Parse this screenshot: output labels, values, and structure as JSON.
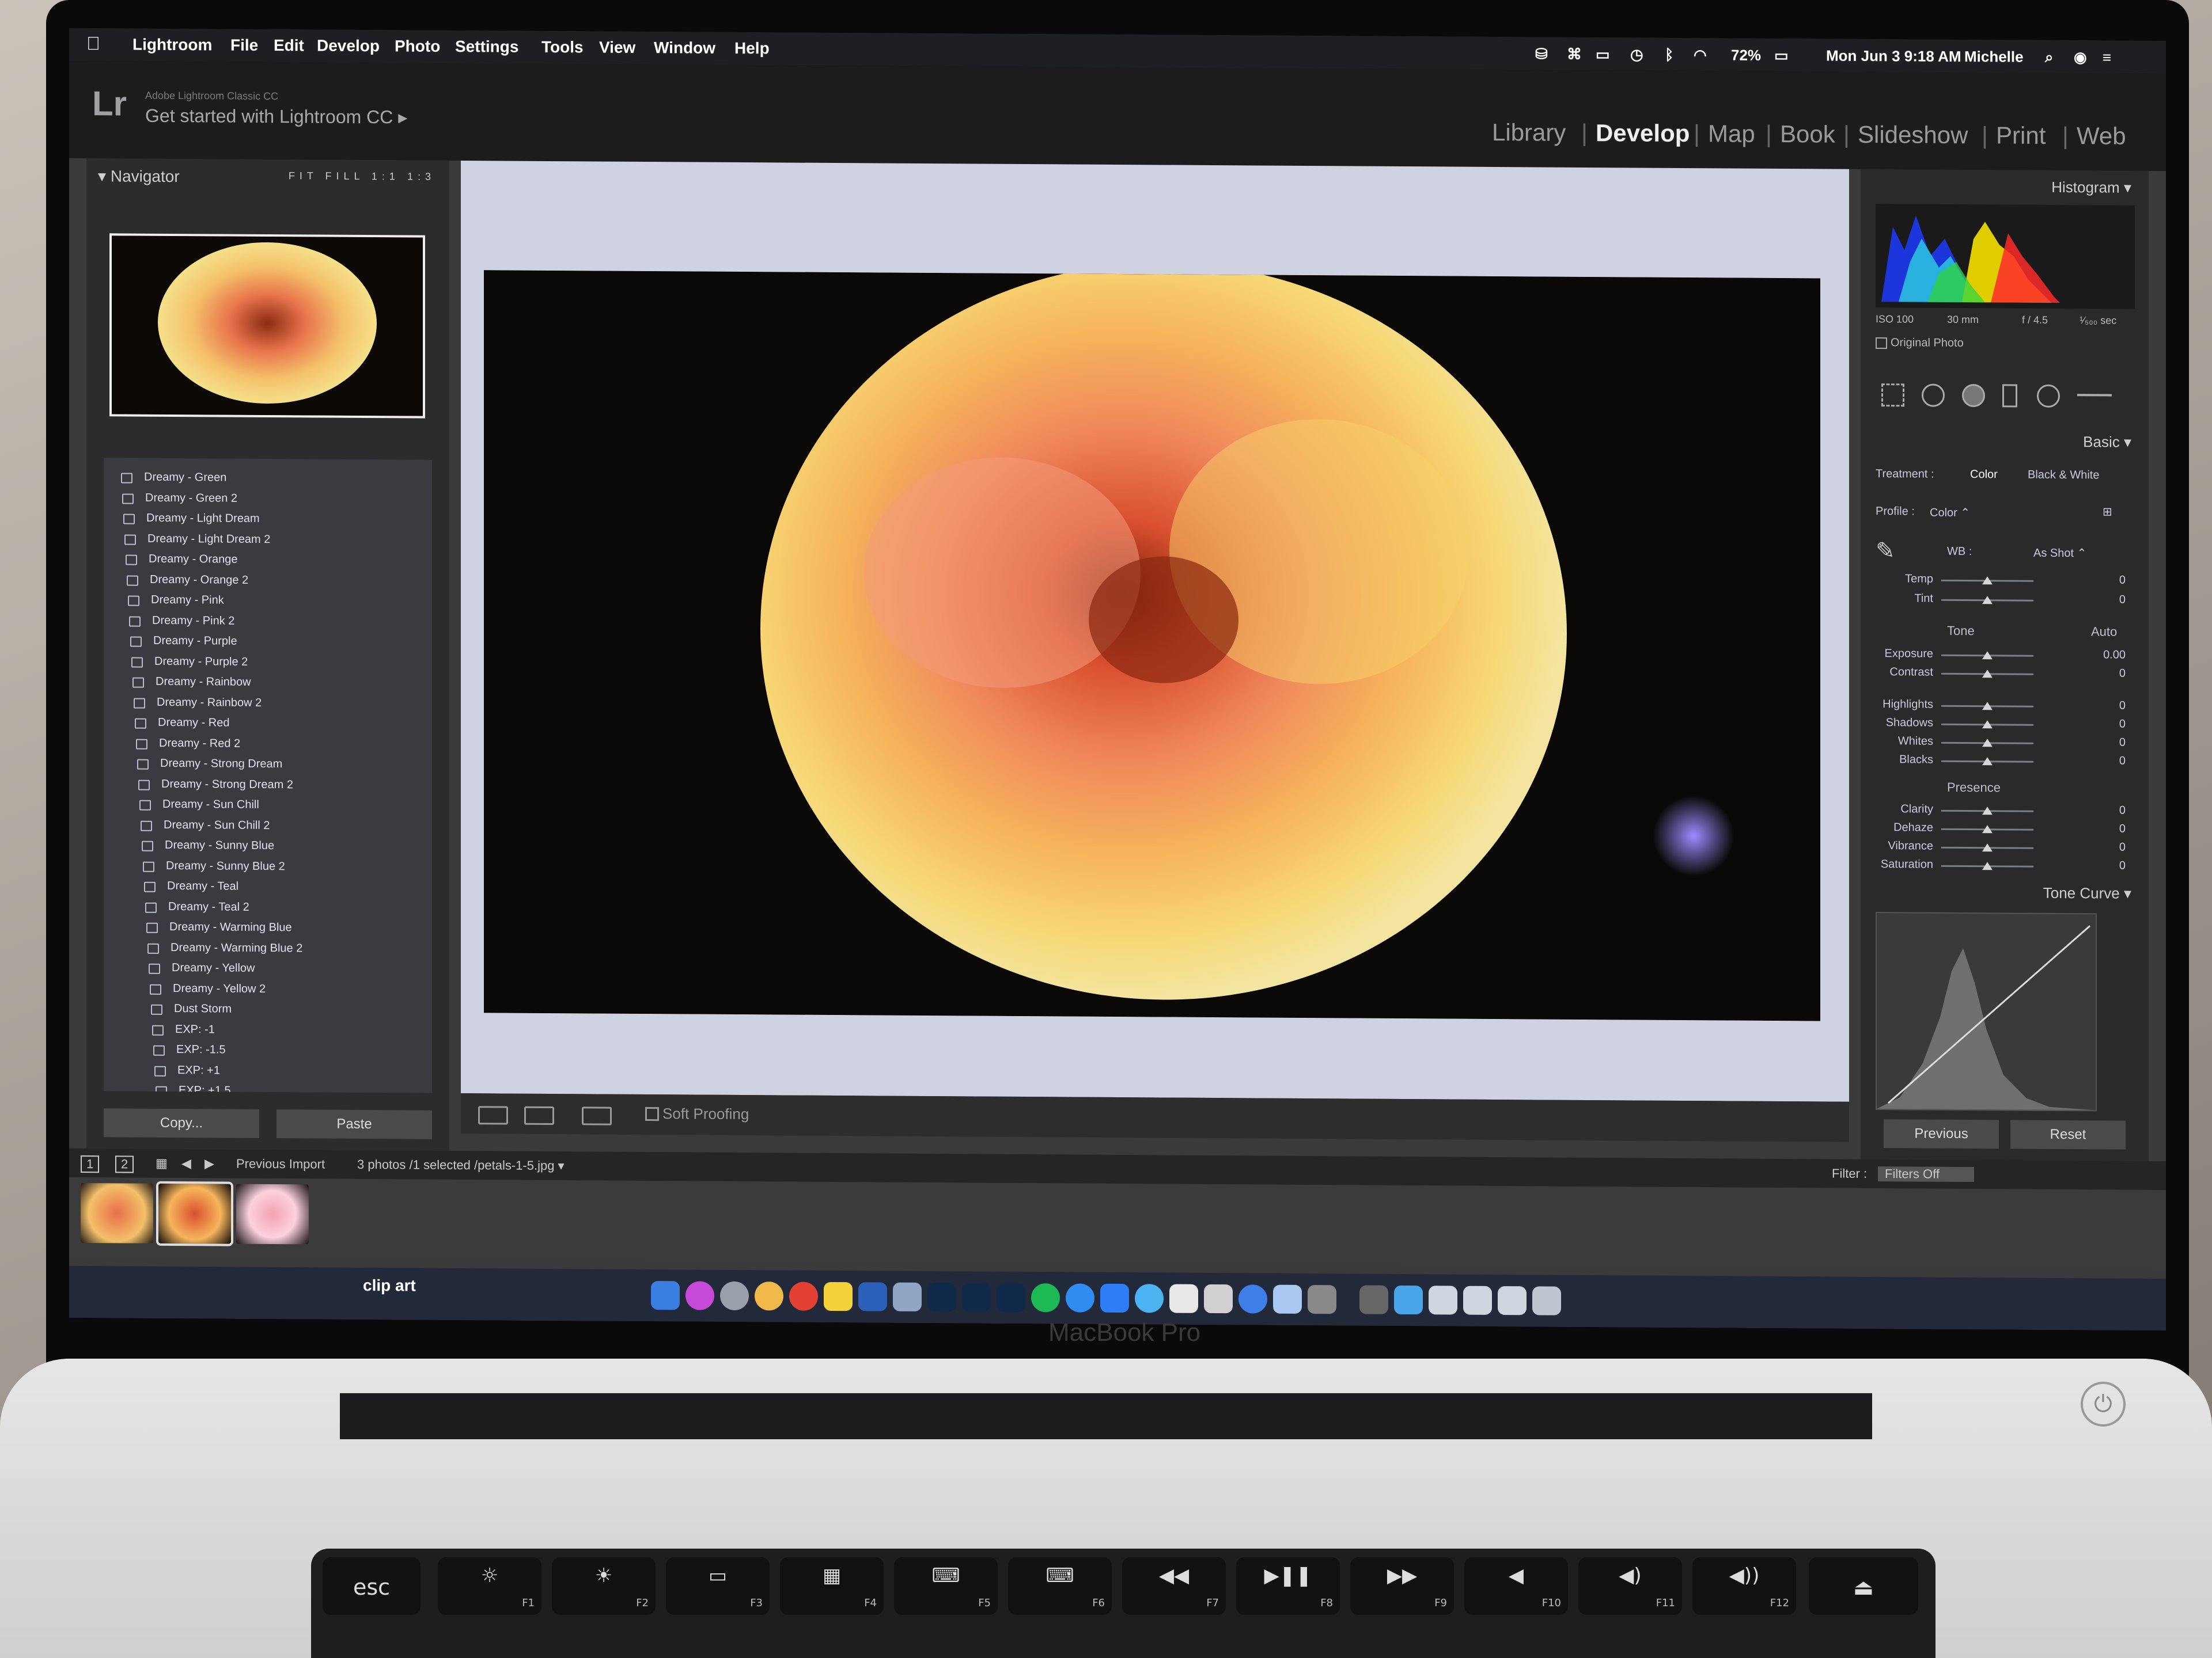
{
  "menubar": {
    "app": "Lightroom",
    "items": [
      "File",
      "Edit",
      "Develop",
      "Photo",
      "Settings",
      "Tools",
      "View",
      "Window",
      "Help"
    ],
    "battery": "72%",
    "datetime": "Mon Jun 3  9:18 AM",
    "user": "Michelle"
  },
  "lr": {
    "logo": "Lr",
    "subtitle": "Adobe Lightroom Classic CC",
    "task": "Get started with Lightroom CC  ▸",
    "modules": [
      "Library",
      "Develop",
      "Map",
      "Book",
      "Slideshow",
      "Print",
      "Web"
    ],
    "active_module": "Develop"
  },
  "navigator": {
    "title": "Navigator",
    "options": [
      "FIT",
      "FILL",
      "1:1",
      "1:3"
    ]
  },
  "presets": [
    "Dreamy - Green",
    "Dreamy - Green 2",
    "Dreamy - Light Dream",
    "Dreamy - Light Dream 2",
    "Dreamy - Orange",
    "Dreamy - Orange 2",
    "Dreamy - Pink",
    "Dreamy - Pink 2",
    "Dreamy - Purple",
    "Dreamy - Purple 2",
    "Dreamy - Rainbow",
    "Dreamy - Rainbow 2",
    "Dreamy - Red",
    "Dreamy - Red 2",
    "Dreamy - Strong Dream",
    "Dreamy - Strong Dream 2",
    "Dreamy - Sun Chill",
    "Dreamy - Sun Chill 2",
    "Dreamy - Sunny Blue",
    "Dreamy - Sunny Blue 2",
    "Dreamy - Teal",
    "Dreamy - Teal 2",
    "Dreamy - Warming Blue",
    "Dreamy - Warming Blue 2",
    "Dreamy - Yellow",
    "Dreamy - Yellow 2",
    "Dust Storm",
    "EXP: -1",
    "EXP: -1.5",
    "EXP: +1",
    "EXP: +1.5"
  ],
  "left_buttons": {
    "copy": "Copy...",
    "paste": "Paste"
  },
  "toolbar": {
    "soft_proofing": "Soft Proofing"
  },
  "right": {
    "histogram_title": "Histogram",
    "exif": {
      "iso": "ISO 100",
      "focal": "30 mm",
      "aperture": "f / 4.5",
      "shutter": "¹⁄₅₀₀ sec"
    },
    "original_photo": "Original Photo",
    "basic_title": "Basic",
    "treatment_label": "Treatment :",
    "treatment_color": "Color",
    "treatment_bw": "Black & White",
    "profile_label": "Profile :",
    "profile_value": "Color  ⌃",
    "wb_label": "WB :",
    "wb_value": "As Shot  ⌃",
    "temp_tint": [
      {
        "label": "Temp",
        "value": "0"
      },
      {
        "label": "Tint",
        "value": "0"
      }
    ],
    "tone_label": "Tone",
    "auto_label": "Auto",
    "tone_sliders": [
      {
        "label": "Exposure",
        "value": "0.00"
      },
      {
        "label": "Contrast",
        "value": "0"
      },
      {
        "label": "Highlights",
        "value": "0"
      },
      {
        "label": "Shadows",
        "value": "0"
      },
      {
        "label": "Whites",
        "value": "0"
      },
      {
        "label": "Blacks",
        "value": "0"
      }
    ],
    "presence_label": "Presence",
    "presence_sliders": [
      {
        "label": "Clarity",
        "value": "0"
      },
      {
        "label": "Dehaze",
        "value": "0"
      },
      {
        "label": "Vibrance",
        "value": "0"
      },
      {
        "label": "Saturation",
        "value": "0"
      }
    ],
    "tone_curve_title": "Tone Curve",
    "previous": "Previous",
    "reset": "Reset"
  },
  "filmstrip": {
    "page1": "1",
    "page2": "2",
    "source": "Previous Import",
    "selection": "3 photos /1 selected /petals-1-5.jpg ▾",
    "filter_label": "Filter :",
    "filter_value": "Filters Off"
  },
  "dock": {
    "label": "clip art"
  },
  "laptop": {
    "brand": "MacBook Pro",
    "fkeys": [
      "F1",
      "F2",
      "F3",
      "F4",
      "F5",
      "F6",
      "F7",
      "F8",
      "F9",
      "F10",
      "F11",
      "F12"
    ],
    "esc": "esc"
  },
  "colors": {
    "accent": "#f0f0f0",
    "panel": "#2c2c2c",
    "preset_bg": "#3a3b40",
    "photo_bg": "#0b0907"
  }
}
